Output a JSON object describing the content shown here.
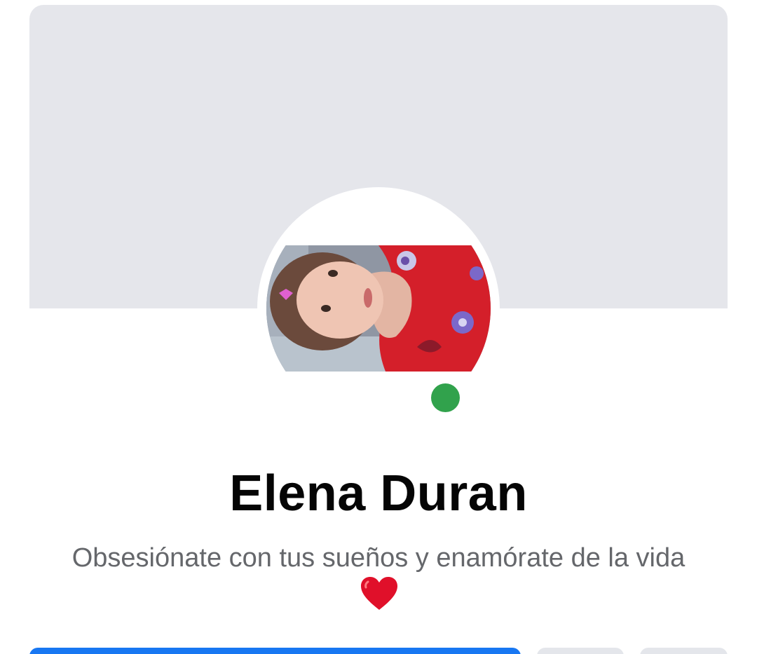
{
  "profile": {
    "name": "Elena Duran",
    "bio_text": "Obsesiónate con tus sueños y enamórate de la vida",
    "bio_emoji_icon": "red-heart-icon",
    "online_status": "online",
    "avatar_icon": "profile-photo"
  },
  "colors": {
    "cover_background": "#e5e6eb",
    "online_dot": "#31a24c",
    "primary_button": "#1877f2",
    "secondary_button": "#e4e6eb",
    "name_text": "#050505",
    "bio_text": "#65676b",
    "heart": "#e0102a"
  }
}
